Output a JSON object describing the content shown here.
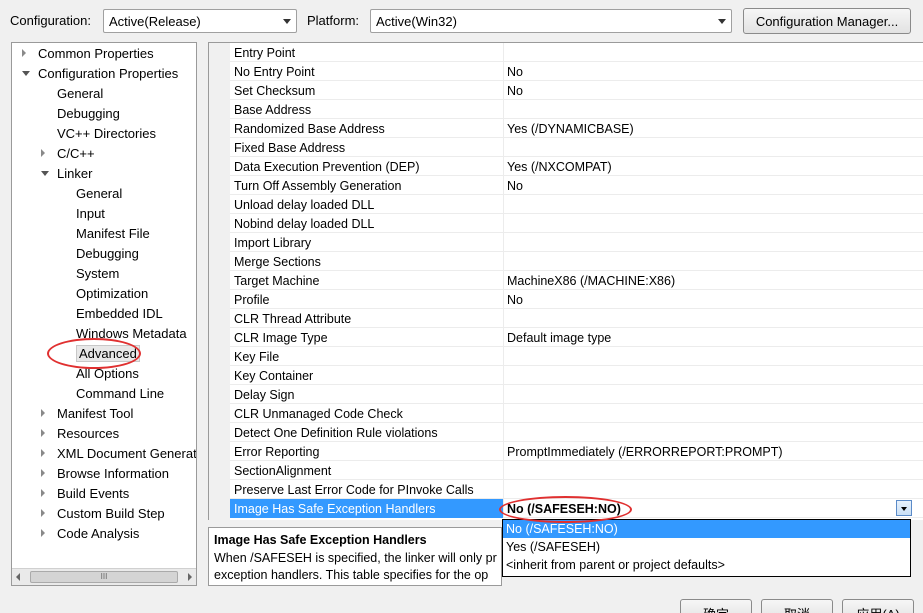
{
  "toolbar": {
    "configuration_label": "Configuration:",
    "configuration_value": "Active(Release)",
    "platform_label": "Platform:",
    "platform_value": "Active(Win32)",
    "config_manager_button": "Configuration Manager..."
  },
  "tree": [
    {
      "label": "Common Properties",
      "level": 0,
      "expander": "closed"
    },
    {
      "label": "Configuration Properties",
      "level": 0,
      "expander": "open"
    },
    {
      "label": "General",
      "level": 1,
      "expander": "none"
    },
    {
      "label": "Debugging",
      "level": 1,
      "expander": "none"
    },
    {
      "label": "VC++ Directories",
      "level": 1,
      "expander": "none"
    },
    {
      "label": "C/C++",
      "level": 1,
      "expander": "closed"
    },
    {
      "label": "Linker",
      "level": 1,
      "expander": "open"
    },
    {
      "label": "General",
      "level": 2,
      "expander": "none"
    },
    {
      "label": "Input",
      "level": 2,
      "expander": "none"
    },
    {
      "label": "Manifest File",
      "level": 2,
      "expander": "none"
    },
    {
      "label": "Debugging",
      "level": 2,
      "expander": "none"
    },
    {
      "label": "System",
      "level": 2,
      "expander": "none"
    },
    {
      "label": "Optimization",
      "level": 2,
      "expander": "none"
    },
    {
      "label": "Embedded IDL",
      "level": 2,
      "expander": "none"
    },
    {
      "label": "Windows Metadata",
      "level": 2,
      "expander": "none"
    },
    {
      "label": "Advanced",
      "level": 2,
      "expander": "none",
      "selected": true
    },
    {
      "label": "All Options",
      "level": 2,
      "expander": "none"
    },
    {
      "label": "Command Line",
      "level": 2,
      "expander": "none"
    },
    {
      "label": "Manifest Tool",
      "level": 1,
      "expander": "closed"
    },
    {
      "label": "Resources",
      "level": 1,
      "expander": "closed"
    },
    {
      "label": "XML Document Generat",
      "level": 1,
      "expander": "closed"
    },
    {
      "label": "Browse Information",
      "level": 1,
      "expander": "closed"
    },
    {
      "label": "Build Events",
      "level": 1,
      "expander": "closed"
    },
    {
      "label": "Custom Build Step",
      "level": 1,
      "expander": "closed"
    },
    {
      "label": "Code Analysis",
      "level": 1,
      "expander": "closed"
    }
  ],
  "tree_scrollbar_thumb": "III",
  "properties": [
    {
      "name": "Entry Point",
      "value": ""
    },
    {
      "name": "No Entry Point",
      "value": "No"
    },
    {
      "name": "Set Checksum",
      "value": "No"
    },
    {
      "name": "Base Address",
      "value": ""
    },
    {
      "name": "Randomized Base Address",
      "value": "Yes (/DYNAMICBASE)"
    },
    {
      "name": "Fixed Base Address",
      "value": ""
    },
    {
      "name": "Data Execution Prevention (DEP)",
      "value": "Yes (/NXCOMPAT)"
    },
    {
      "name": "Turn Off Assembly Generation",
      "value": "No"
    },
    {
      "name": "Unload delay loaded DLL",
      "value": ""
    },
    {
      "name": "Nobind delay loaded DLL",
      "value": ""
    },
    {
      "name": "Import Library",
      "value": ""
    },
    {
      "name": "Merge Sections",
      "value": ""
    },
    {
      "name": "Target Machine",
      "value": "MachineX86 (/MACHINE:X86)"
    },
    {
      "name": "Profile",
      "value": "No"
    },
    {
      "name": "CLR Thread Attribute",
      "value": ""
    },
    {
      "name": "CLR Image Type",
      "value": "Default image type"
    },
    {
      "name": "Key File",
      "value": ""
    },
    {
      "name": "Key Container",
      "value": ""
    },
    {
      "name": "Delay Sign",
      "value": ""
    },
    {
      "name": "CLR Unmanaged Code Check",
      "value": ""
    },
    {
      "name": "Detect One Definition Rule violations",
      "value": ""
    },
    {
      "name": "Error Reporting",
      "value": "PromptImmediately (/ERRORREPORT:PROMPT)"
    },
    {
      "name": "SectionAlignment",
      "value": ""
    },
    {
      "name": "Preserve Last Error Code for PInvoke Calls",
      "value": ""
    },
    {
      "name": "Image Has Safe Exception Handlers",
      "value": "No (/SAFESEH:NO)",
      "selected": true
    }
  ],
  "dropdown_options": [
    {
      "label": "No (/SAFESEH:NO)",
      "highlighted": true
    },
    {
      "label": "Yes (/SAFESEH)",
      "highlighted": false
    },
    {
      "label": "<inherit from parent or project defaults>",
      "highlighted": false
    }
  ],
  "description": {
    "title": "Image Has Safe Exception Handlers",
    "line1": "When /SAFESEH is specified, the linker will only pr",
    "line2": "exception handlers. This table specifies for the op"
  },
  "bottom_buttons": {
    "ok": "确定",
    "cancel": "取消",
    "apply": "应用(A)"
  },
  "colors": {
    "selection": "#3399ff",
    "annotation": "#e03030"
  }
}
